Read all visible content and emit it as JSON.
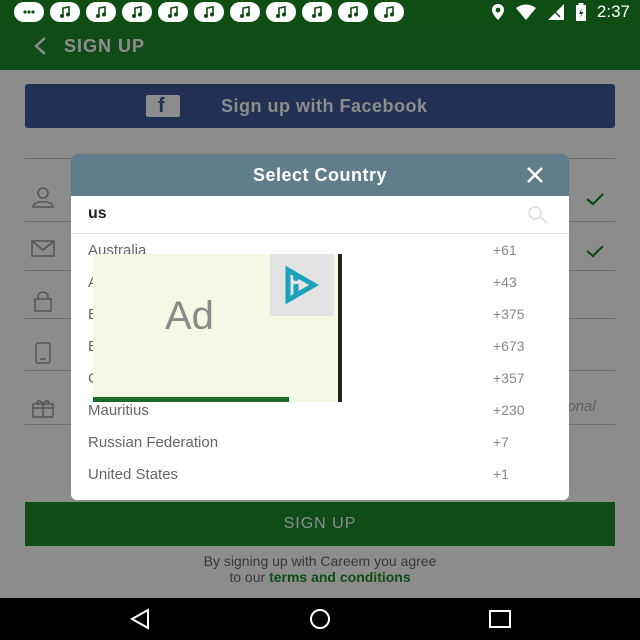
{
  "status_bar": {
    "time": "2:37"
  },
  "toolbar": {
    "title": "SIGN UP"
  },
  "facebook": {
    "label": "Sign up with Facebook"
  },
  "form": {
    "optional_text": "ional"
  },
  "signup_button": {
    "label": "SIGN UP"
  },
  "terms": {
    "line1": "By signing up with Careem you agree",
    "line2_prefix": "to our",
    "link": "terms and conditions"
  },
  "dialog": {
    "title": "Select Country",
    "search_value": "us",
    "rows": [
      {
        "name": "Australia",
        "code": "+61"
      },
      {
        "name": "A",
        "code": "+43"
      },
      {
        "name": "B",
        "code": "+375"
      },
      {
        "name": "B",
        "code": "+673"
      },
      {
        "name": "C",
        "code": "+357"
      },
      {
        "name": "Mauritius",
        "code": "+230"
      },
      {
        "name": "Russian Federation",
        "code": "+7"
      },
      {
        "name": "United States",
        "code": "+1"
      }
    ]
  },
  "ad": {
    "label": "Ad"
  },
  "colors": {
    "primary": "#1d8a2b",
    "dark": "#0e4d14",
    "facebook": "#3b5998",
    "dialog_header": "#607d8b"
  }
}
